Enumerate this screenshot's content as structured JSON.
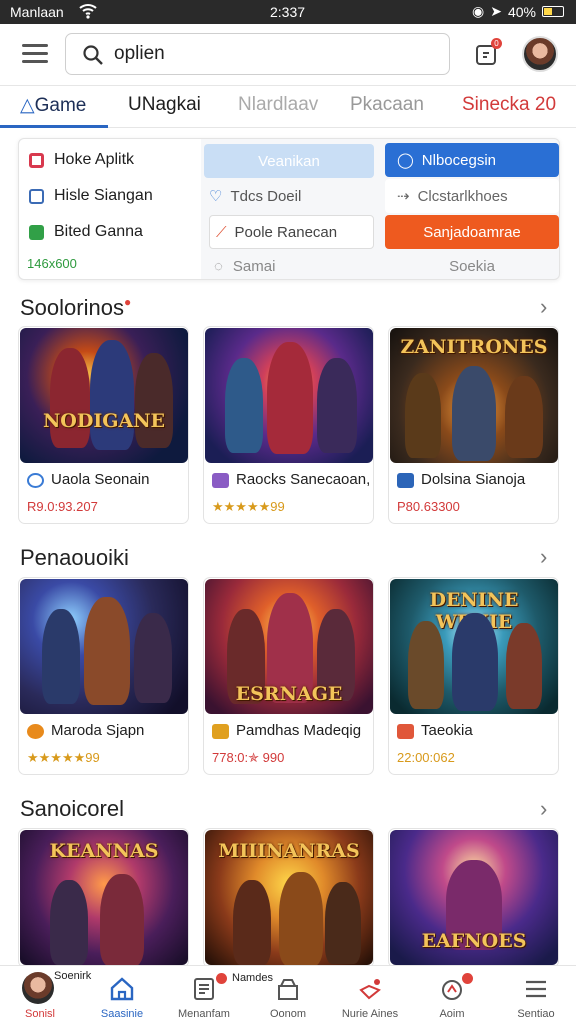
{
  "status": {
    "left": "Manlaan",
    "time": "2:337",
    "battery": "40%"
  },
  "search": {
    "value": "oplien"
  },
  "notif_count": "0",
  "tabs": [
    {
      "label": "Game"
    },
    {
      "label": "UNagkai"
    },
    {
      "label": "Nlardlaav"
    },
    {
      "label": "Pkacaan"
    },
    {
      "label": "Sinecka 20"
    }
  ],
  "panel": {
    "left": [
      {
        "label": "Hoke Aplitk",
        "color": "#d8394e"
      },
      {
        "label": "Hisle Siangan",
        "color": "#3b6bb5"
      },
      {
        "label": "Bited Ganna",
        "color": "#31a047"
      }
    ],
    "count": "146x600",
    "mid": [
      {
        "label": "Veanikan"
      },
      {
        "label": "Tdcs Doeil"
      },
      {
        "label": "Poole Ranecan"
      },
      {
        "label": "Samai"
      }
    ],
    "right": [
      {
        "label": "Nlbocegsin"
      },
      {
        "label": "Clcstarlkhoes"
      },
      {
        "label": "Sanjadoamrae"
      },
      {
        "label": "Soekia"
      }
    ]
  },
  "sections": [
    {
      "title": "Soolorinos",
      "cards": [
        {
          "name": "Uaola Seonain",
          "meta": "R9.0:93.207",
          "thumb": "NODIGANE",
          "icon": "#3a7bd5"
        },
        {
          "name": "Raocks Sanecaoan,",
          "meta": "★★★★★99",
          "thumb": "",
          "icon": "#8a5cc4"
        },
        {
          "name": "Dolsina Sianoja",
          "meta": "P80.63300",
          "thumb": "ZANITRONES",
          "icon": "#2c65b8"
        }
      ]
    },
    {
      "title": "Penaouoiki",
      "cards": [
        {
          "name": "Maroda Sjapn",
          "meta": "★★★★★99",
          "thumb": "",
          "icon": "#e88a1c"
        },
        {
          "name": "Pamdhas Madeqig",
          "meta": "778:0:✯ 990",
          "thumb": "ESRNAGE",
          "icon": "#e0a020"
        },
        {
          "name": "Taeokia",
          "meta": "22:00:062",
          "thumb": "DENINE WENIE",
          "icon": "#e0573a"
        }
      ]
    },
    {
      "title": "Sanoicorel",
      "cards": [
        {
          "thumb": "KEANNAS"
        },
        {
          "thumb": "MIIINANRAS"
        },
        {
          "thumb": "EAFNOES"
        }
      ]
    }
  ],
  "nav": [
    {
      "label": "Sonisl",
      "top": "Soenirk"
    },
    {
      "label": "Saasinie"
    },
    {
      "label": "Menanfam"
    },
    {
      "label": "Oonom",
      "top": "Namdes"
    },
    {
      "label": "Nurie Aines"
    },
    {
      "label": "Aoim"
    },
    {
      "label": "Sentiao"
    }
  ]
}
